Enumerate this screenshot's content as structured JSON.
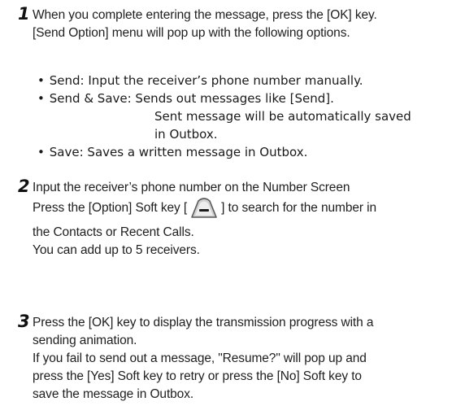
{
  "step1": {
    "number": "1",
    "lines": [
      "When you complete entering the message, press the [OK] key.",
      "[Send Option] menu will pop up with the following options."
    ]
  },
  "options": {
    "bullet": "•",
    "send": "Send: Input the receiver’s phone number manually.",
    "send_save_1": "Send & Save: Sends out messages like [Send].",
    "send_save_2": "Sent message will be automatically saved",
    "send_save_3": "in Outbox.",
    "save": "Save: Saves a written message in Outbox."
  },
  "step2": {
    "number": "2",
    "line1": "Input the receiver’s phone number on the Number Screen",
    "line2_pre": "Press the [Option] Soft key [",
    "line2_post": "] to search for the number in",
    "line3": "the Contacts or Recent Calls.",
    "line4": "You can add up to 5 receivers.",
    "softkey_icon": "left-softkey-icon"
  },
  "step3": {
    "number": "3",
    "lines": [
      "Press the [OK] key to display the transmission progress with a",
      "sending animation.",
      "If you fail to send out a message, \"Resume?\" will pop up and",
      "press the [Yes] Soft key to retry or press the [No] Soft key to",
      "save the message in Outbox."
    ]
  }
}
